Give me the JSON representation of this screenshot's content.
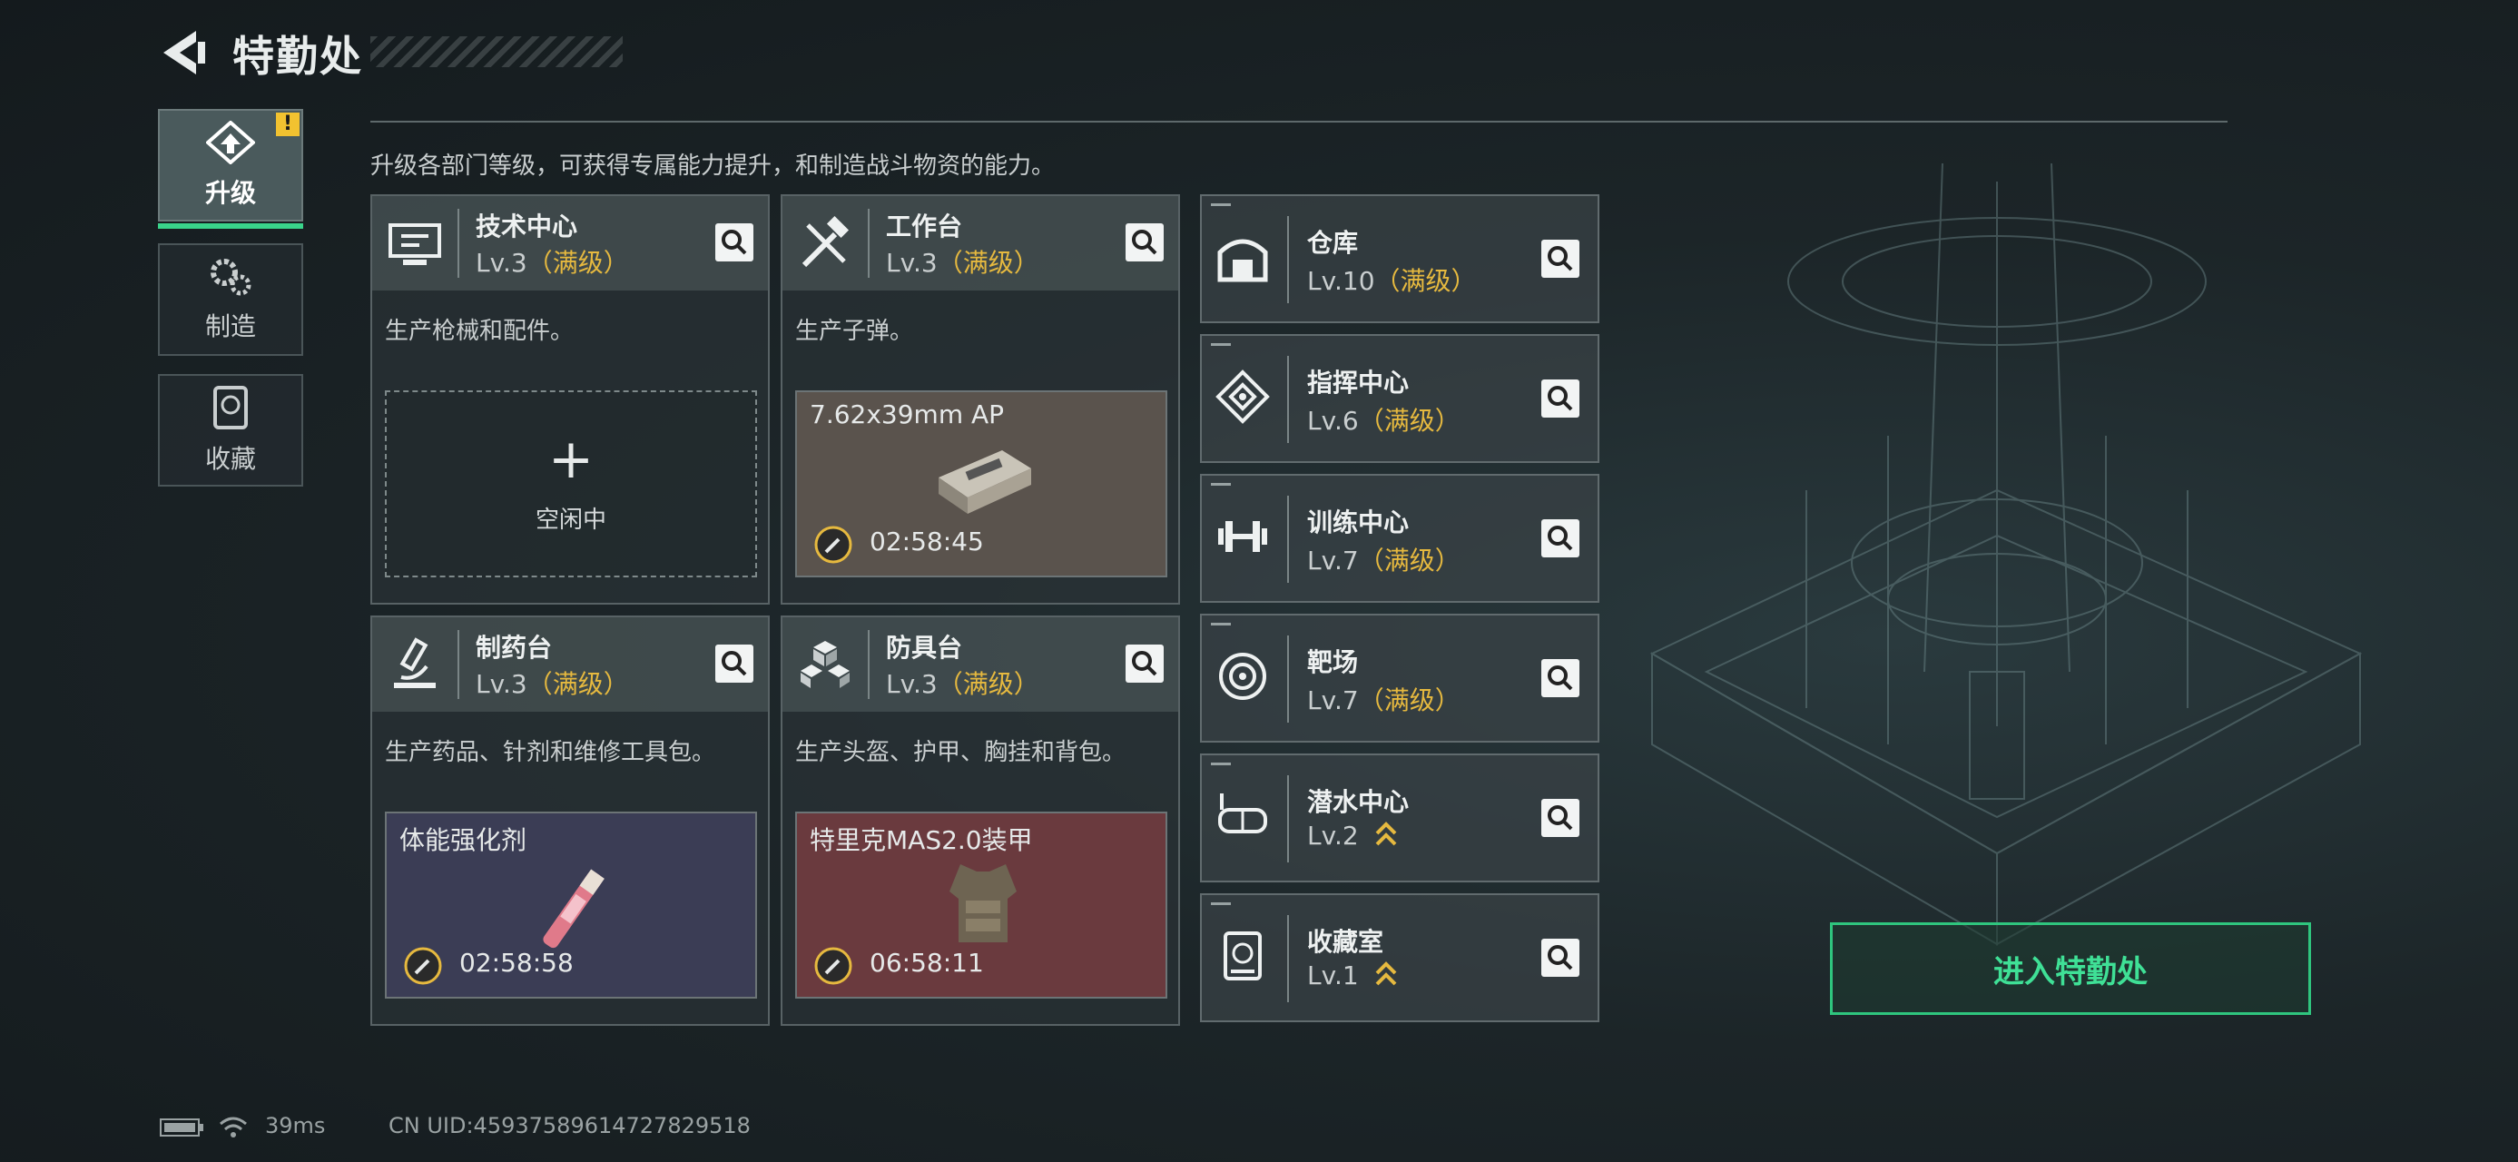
{
  "header": {
    "title": "特勤处",
    "back_icon": "back-arrow-icon"
  },
  "tabs": [
    {
      "label": "升级",
      "icon": "upgrade-icon",
      "active": true,
      "alert": "!"
    },
    {
      "label": "制造",
      "icon": "gears-icon",
      "active": false
    },
    {
      "label": "收藏",
      "icon": "collection-icon",
      "active": false
    }
  ],
  "description": "升级各部门等级，可获得专属能力提升，和制造战斗物资的能力。",
  "facilities": [
    {
      "name": "技术中心",
      "level": "Lv.3",
      "status": "（满级）",
      "desc": "生产枪械和配件。",
      "slot": {
        "idle_text": "空闲中",
        "plus": "+"
      }
    },
    {
      "name": "工作台",
      "level": "Lv.3",
      "status": "（满级）",
      "desc": "生产子弹。",
      "slot": {
        "item": "7.62x39mm AP",
        "timer": "02:58:45"
      }
    },
    {
      "name": "制药台",
      "level": "Lv.3",
      "status": "（满级）",
      "desc": "生产药品、针剂和维修工具包。",
      "slot": {
        "item": "体能强化剂",
        "timer": "02:58:58"
      }
    },
    {
      "name": "防具台",
      "level": "Lv.3",
      "status": "（满级）",
      "desc": "生产头盔、护甲、胸挂和背包。",
      "slot": {
        "item": "特里克MAS2.0装甲",
        "timer": "06:58:11"
      }
    }
  ],
  "side_facilities": [
    {
      "name": "仓库",
      "level": "Lv.10",
      "status": "（满级）"
    },
    {
      "name": "指挥中心",
      "level": "Lv.6",
      "status": "（满级）"
    },
    {
      "name": "训练中心",
      "level": "Lv.7",
      "status": "（满级）"
    },
    {
      "name": "靶场",
      "level": "Lv.7",
      "status": "（满级）"
    },
    {
      "name": "潜水中心",
      "level": "Lv.2",
      "status": ""
    },
    {
      "name": "收藏室",
      "level": "Lv.1",
      "status": ""
    }
  ],
  "enter_button": "进入特勤处",
  "status_bar": {
    "ping": "39ms",
    "uid": "CN UID:4593758961472782951​8"
  },
  "colors": {
    "accent": "#39d38a",
    "maxed": "#e6b93f",
    "alert": "#f2c230"
  }
}
